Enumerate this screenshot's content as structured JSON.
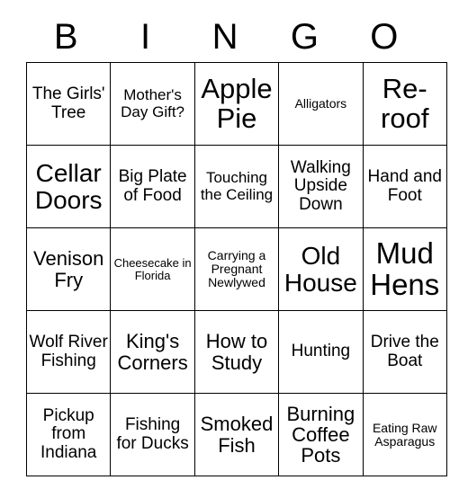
{
  "card": {
    "header": {
      "letters": [
        "B",
        "I",
        "N",
        "G",
        "O"
      ]
    },
    "colors": {
      "border": "#000000",
      "text": "#000000",
      "background": "#ffffff"
    },
    "grid": {
      "rows": 5,
      "columns": 5,
      "cells": [
        [
          {
            "text": "The Girls' Tree",
            "size": "l"
          },
          {
            "text": "Mother's Day Gift?",
            "size": "m"
          },
          {
            "text": "Apple Pie",
            "size": "h1"
          },
          {
            "text": "Alligators",
            "size": "s"
          },
          {
            "text": "Re-roof",
            "size": "h1"
          }
        ],
        [
          {
            "text": "Cellar Doors",
            "size": "xxl"
          },
          {
            "text": "Big Plate of Food",
            "size": "l"
          },
          {
            "text": "Touching the Ceiling",
            "size": "m"
          },
          {
            "text": "Walking Upside Down",
            "size": "l"
          },
          {
            "text": "Hand and Foot",
            "size": "l"
          }
        ],
        [
          {
            "text": "Venison Fry",
            "size": "xl"
          },
          {
            "text": "Cheesecake in Florida",
            "size": "xs"
          },
          {
            "text": "Carrying a Pregnant Newlywed",
            "size": "s"
          },
          {
            "text": "Old House",
            "size": "xxl"
          },
          {
            "text": "Mud Hens",
            "size": "h2"
          }
        ],
        [
          {
            "text": "Wolf River Fishing",
            "size": "l"
          },
          {
            "text": "King's Corners",
            "size": "xl"
          },
          {
            "text": "How to Study",
            "size": "xl"
          },
          {
            "text": "Hunting",
            "size": "l"
          },
          {
            "text": "Drive the Boat",
            "size": "l"
          }
        ],
        [
          {
            "text": "Pickup from Indiana",
            "size": "l"
          },
          {
            "text": "Fishing for Ducks",
            "size": "l"
          },
          {
            "text": "Smoked Fish",
            "size": "xl"
          },
          {
            "text": "Burning Coffee Pots",
            "size": "xl"
          },
          {
            "text": "Eating Raw Asparagus",
            "size": "s"
          }
        ]
      ]
    }
  }
}
